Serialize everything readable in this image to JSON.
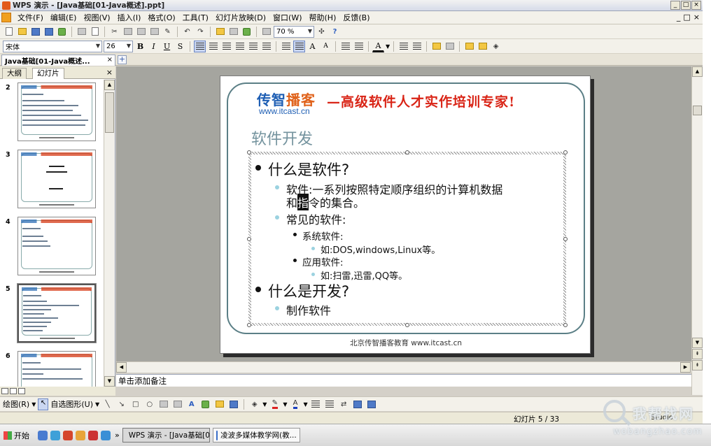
{
  "window": {
    "title": "WPS 演示 - [Java基础[01-Java概述].ppt]",
    "buttons": [
      "_",
      "□",
      "×"
    ]
  },
  "menubar": {
    "items": [
      "文件(F)",
      "编辑(E)",
      "视图(V)",
      "插入(I)",
      "格式(O)",
      "工具(T)",
      "幻灯片放映(D)",
      "窗口(W)",
      "帮助(H)",
      "反馈(B)"
    ],
    "mdi_buttons": [
      "_",
      "□",
      "×"
    ]
  },
  "toolbar": {
    "zoom": "70 %"
  },
  "format_toolbar": {
    "font_name": "宋体",
    "font_size": "26",
    "bold": "B",
    "italic": "I",
    "underline": "U",
    "shadow": "S",
    "grow_font": "A",
    "shrink_font": "A",
    "font_color": "A"
  },
  "doc_tabs": {
    "active_tab": "Java基础[01-Java概述...",
    "close": "×",
    "add": "+"
  },
  "left_panel": {
    "tabs": [
      "大纲",
      "幻灯片"
    ],
    "close": "×",
    "slide_numbers": [
      "2",
      "3",
      "4",
      "5",
      "6"
    ],
    "selected": 5
  },
  "slide": {
    "logo_text_a": "传智",
    "logo_text_b": "播客",
    "logo_url": "www.itcast.cn",
    "slogan": "—高级软件人才实作培训专家!",
    "title": "软件开发",
    "bullets": {
      "q1": "什么是软件?",
      "a1_pre": "软件:一系列按照特定顺序组织的计算机数据",
      "a1_line2_pre": "和",
      "a1_cursor_char": "指",
      "a1_line2_post": "令的集合。",
      "common": "常见的软件:",
      "system": "系统软件:",
      "system_eg": "如:DOS,windows,Linux等。",
      "application": "应用软件:",
      "application_eg": "如:扫雷,迅雷,QQ等。",
      "q2": "什么是开发?",
      "a2": "制作软件"
    },
    "footer": "北京传智播客教育 www.itcast.cn"
  },
  "notes": {
    "placeholder": "单击添加备注"
  },
  "drawbar": {
    "draw": "绘图(R)",
    "autoshapes": "自选图形(U)"
  },
  "status": {
    "slide_indicator": "幻灯片 5 / 33",
    "slide_suffix": "Studio"
  },
  "taskbar": {
    "start": "开始",
    "tasks": [
      "WPS 演示 - [Java基础[0...",
      "凌波多媒体教学网(教..."
    ],
    "overflow": "»"
  },
  "watermark": {
    "line1": "我帮找网",
    "line2": "wobangzhao.com"
  },
  "colors": {
    "accent_blue": "#1f5fb4",
    "slogan_red": "#d92416",
    "title_teal": "#74939e",
    "bullet_light": "#9bd2e0"
  }
}
